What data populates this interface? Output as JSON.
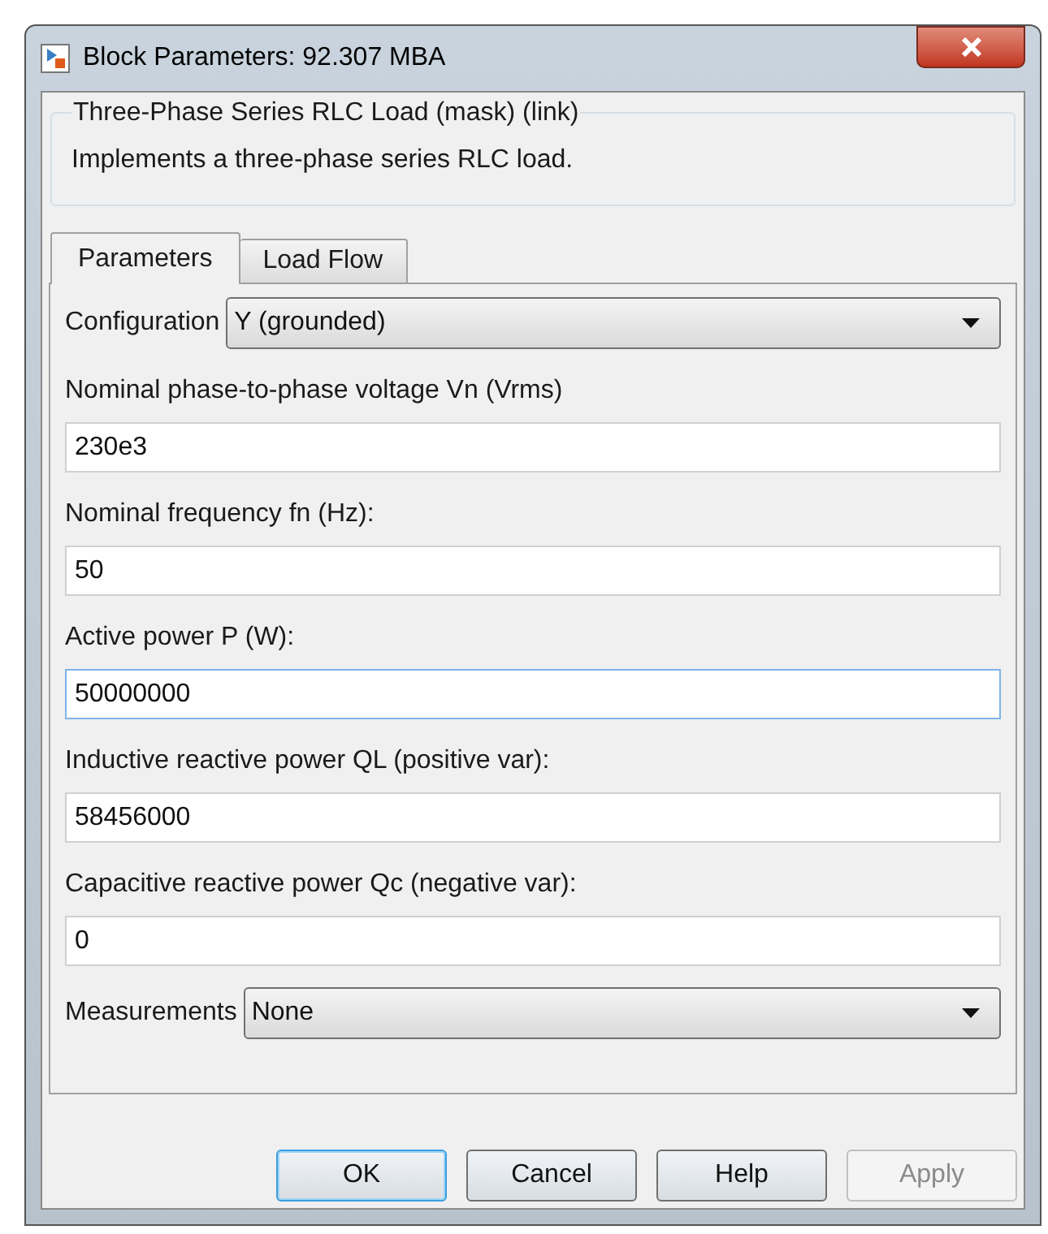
{
  "window": {
    "title": "Block Parameters: 92.307 MBA"
  },
  "mask": {
    "title": "Three-Phase Series RLC Load (mask) (link)",
    "description": "Implements a three-phase series RLC load."
  },
  "tabs": [
    {
      "label": "Parameters",
      "selected": true
    },
    {
      "label": "Load Flow",
      "selected": false
    }
  ],
  "parameters": [
    {
      "kind": "dropdown",
      "label": "Configuration",
      "value": "Y (grounded)"
    },
    {
      "kind": "field",
      "label": "Nominal phase-to-phase voltage Vn (Vrms)",
      "value": "230e3",
      "focused": false
    },
    {
      "kind": "field",
      "label": "Nominal frequency fn (Hz):",
      "value": "50",
      "focused": false
    },
    {
      "kind": "field",
      "label": "Active power P (W):",
      "value": "50000000",
      "focused": true
    },
    {
      "kind": "field",
      "label": "Inductive reactive power QL (positive var):",
      "value": "58456000",
      "focused": false
    },
    {
      "kind": "field",
      "label": "Capacitive reactive power Qc (negative var):",
      "value": "0",
      "focused": false
    },
    {
      "kind": "dropdown",
      "label": "Measurements",
      "value": "None"
    }
  ],
  "buttons": [
    {
      "label": "OK",
      "default": true,
      "disabled": false
    },
    {
      "label": "Cancel",
      "default": false,
      "disabled": false
    },
    {
      "label": "Help",
      "default": false,
      "disabled": false
    },
    {
      "label": "Apply",
      "default": false,
      "disabled": true
    }
  ]
}
